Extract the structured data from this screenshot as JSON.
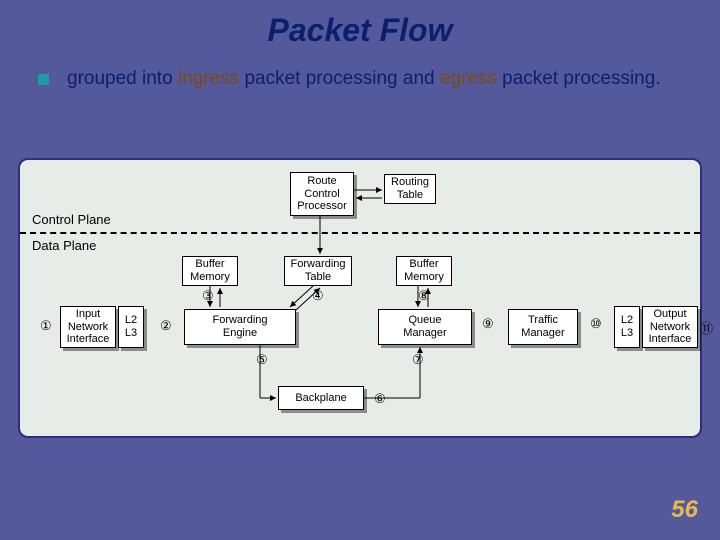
{
  "title": "Packet Flow",
  "description": {
    "pre": "grouped into ",
    "kw1": "ingress",
    "mid1": " packet processing and ",
    "kw2": "egress",
    "mid2": " packet processing."
  },
  "planes": {
    "control": "Control Plane",
    "data": "Data Plane"
  },
  "boxes": {
    "route_ctrl": "Route\nControl\nProcessor",
    "routing_table": "Routing\nTable",
    "buffer_mem1": "Buffer\nMemory",
    "fwd_table": "Forwarding\nTable",
    "buffer_mem2": "Buffer\nMemory",
    "input_if": "Input\nNetwork\nInterface",
    "l2l3a": "L2\nL3",
    "fwd_engine": "Forwarding\nEngine",
    "queue_mgr": "Queue\nManager",
    "traffic_mgr": "Traffic\nManager",
    "l2l3b": "L2\nL3",
    "output_if": "Output\nNetwork\nInterface",
    "backplane": "Backplane"
  },
  "numbers": {
    "n1": "①",
    "n2": "②",
    "n3": "③",
    "n4": "④",
    "n5": "⑤",
    "n6": "⑥",
    "n7": "⑦",
    "n8": "⑧",
    "n9": "⑨",
    "n10": "⑩",
    "n11": "⑪"
  },
  "slide_number": "56"
}
